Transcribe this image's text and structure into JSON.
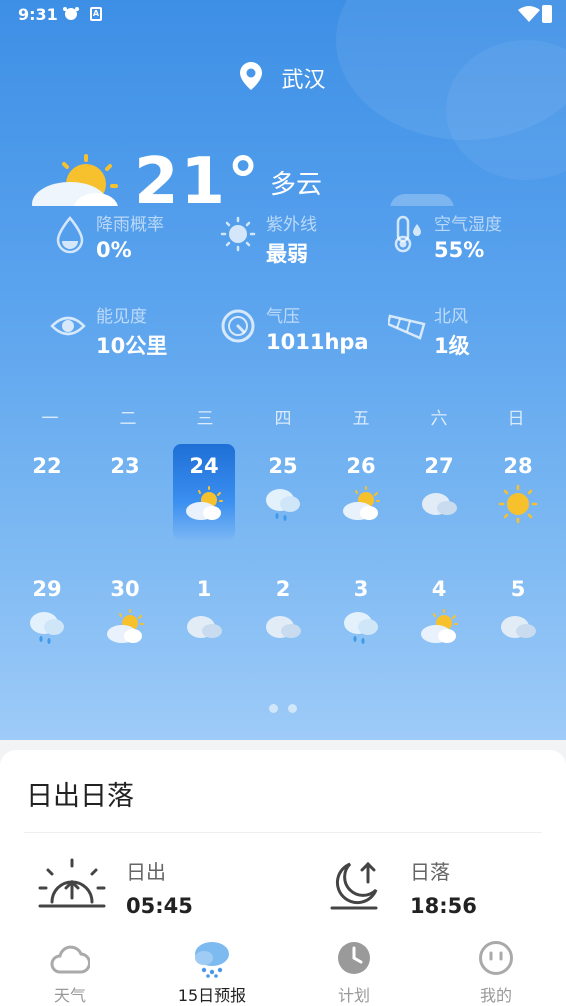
{
  "status_bar": {
    "time": "9:31"
  },
  "location": {
    "city": "武汉"
  },
  "current": {
    "temperature": "21°",
    "condition": "多云"
  },
  "details": [
    {
      "label": "降雨概率",
      "value": "0%",
      "icon": "raindrop-icon"
    },
    {
      "label": "紫外线",
      "value": "最弱",
      "icon": "sun-uv-icon"
    },
    {
      "label": "空气湿度",
      "value": "55%",
      "icon": "thermometer-icon"
    },
    {
      "label": "能见度",
      "value": "10公里",
      "icon": "eye-icon"
    },
    {
      "label": "气压",
      "value": "1011hpa",
      "icon": "gauge-icon"
    },
    {
      "label": "北风",
      "value": "1级",
      "icon": "windsock-icon"
    }
  ],
  "weekdays": [
    "一",
    "二",
    "三",
    "四",
    "五",
    "六",
    "日"
  ],
  "days_row1": [
    {
      "day": "22",
      "icon": "none"
    },
    {
      "day": "23",
      "icon": "none"
    },
    {
      "day": "24",
      "icon": "partly-cloudy-icon",
      "selected": true
    },
    {
      "day": "25",
      "icon": "cloud-rain-icon"
    },
    {
      "day": "26",
      "icon": "partly-cloudy-icon"
    },
    {
      "day": "27",
      "icon": "cloud-icon"
    },
    {
      "day": "28",
      "icon": "sunny-icon"
    }
  ],
  "days_row2": [
    {
      "day": "29",
      "icon": "cloud-rain-icon"
    },
    {
      "day": "30",
      "icon": "partly-cloudy-icon"
    },
    {
      "day": "1",
      "icon": "cloud-icon"
    },
    {
      "day": "2",
      "icon": "cloud-icon"
    },
    {
      "day": "3",
      "icon": "cloud-rain-icon"
    },
    {
      "day": "4",
      "icon": "partly-cloudy-icon"
    },
    {
      "day": "5",
      "icon": "cloud-icon"
    }
  ],
  "sun": {
    "title": "日出日落",
    "sunrise_label": "日出",
    "sunrise_time": "05:45",
    "sunset_label": "日落",
    "sunset_time": "18:56"
  },
  "tabs": [
    {
      "label": "天气",
      "active": false
    },
    {
      "label": "15日预报",
      "active": true
    },
    {
      "label": "计划",
      "active": false
    },
    {
      "label": "我的",
      "active": false
    }
  ],
  "colors": {
    "sky_top": "#3d8fe6",
    "sky_bottom": "#9ecbf8",
    "sun": "#f7c12e",
    "selected_day": "#1e6fd6"
  }
}
